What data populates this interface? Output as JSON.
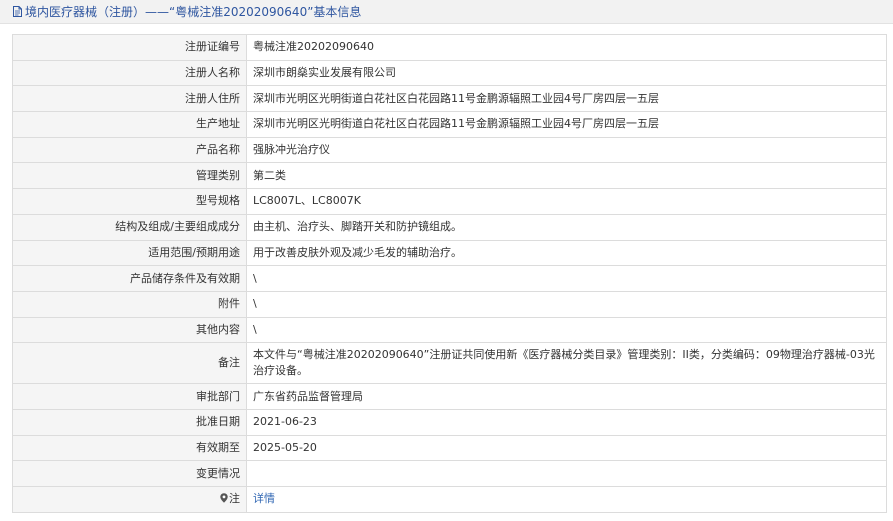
{
  "header": {
    "title": "境内医疗器械（注册）——“粤械注准20202090640”基本信息"
  },
  "rows": [
    {
      "label": "注册证编号",
      "value": "粤械注准20202090640"
    },
    {
      "label": "注册人名称",
      "value": "深圳市朗燊实业发展有限公司"
    },
    {
      "label": "注册人住所",
      "value": "深圳市光明区光明街道白花社区白花园路11号金鹏源辐照工业园4号厂房四层一五层"
    },
    {
      "label": "生产地址",
      "value": "深圳市光明区光明街道白花社区白花园路11号金鹏源辐照工业园4号厂房四层一五层"
    },
    {
      "label": "产品名称",
      "value": "强脉冲光治疗仪"
    },
    {
      "label": "管理类别",
      "value": "第二类"
    },
    {
      "label": "型号规格",
      "value": "LC8007L、LC8007K"
    },
    {
      "label": "结构及组成/主要组成成分",
      "value": "由主机、治疗头、脚踏开关和防护镜组成。"
    },
    {
      "label": "适用范围/预期用途",
      "value": "用于改善皮肤外观及减少毛发的辅助治疗。"
    },
    {
      "label": "产品储存条件及有效期",
      "value": "\\"
    },
    {
      "label": "附件",
      "value": "\\"
    },
    {
      "label": "其他内容",
      "value": "\\"
    },
    {
      "label": "备注",
      "value": "本文件与“粤械注准20202090640”注册证共同使用新《医疗器械分类目录》管理类别：II类，分类编码：09物理治疗器械-03光治疗设备。"
    },
    {
      "label": "审批部门",
      "value": "广东省药品监督管理局"
    },
    {
      "label": "批准日期",
      "value": "2021-06-23"
    },
    {
      "label": "有效期至",
      "value": "2025-05-20"
    },
    {
      "label": "变更情况",
      "value": ""
    }
  ],
  "note_row": {
    "label": "注",
    "icon": "location-pin-icon",
    "link_text": "详情"
  },
  "colors": {
    "title_text": "#2f56a0",
    "label_bg": "#f5f5f5",
    "border": "#dcdcdc",
    "link": "#2f66b3"
  }
}
